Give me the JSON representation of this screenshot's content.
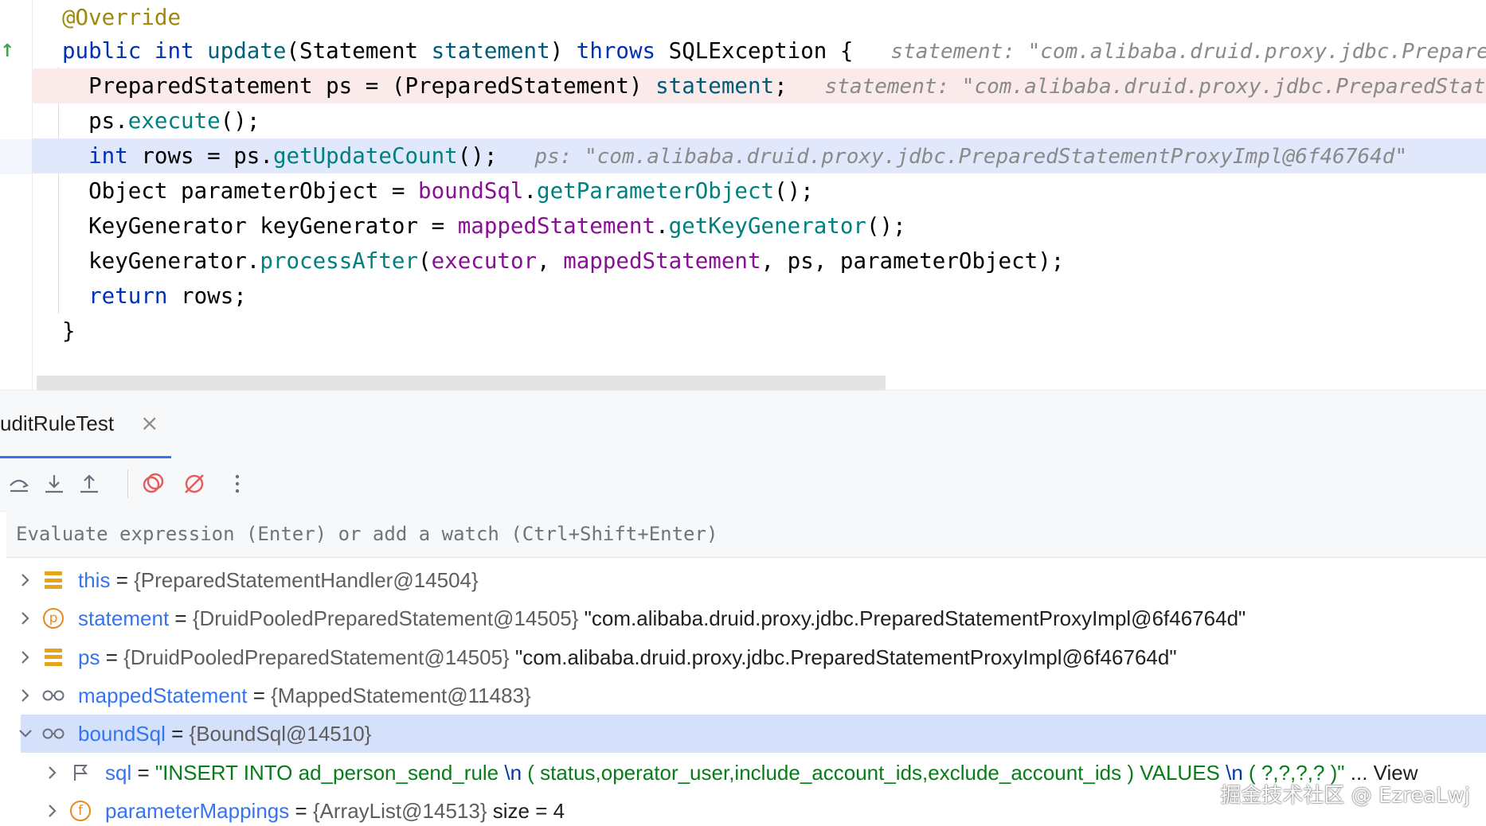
{
  "editor": {
    "lines": [
      [
        {
          "t": "@Override",
          "c": "ann"
        }
      ],
      [
        {
          "t": "public ",
          "c": "kw"
        },
        {
          "t": "int ",
          "c": "kw"
        },
        {
          "t": "update",
          "c": "fn"
        },
        {
          "t": "(",
          "c": "pn"
        },
        {
          "t": "Statement ",
          "c": "pn"
        },
        {
          "t": "statement",
          "c": "prm"
        },
        {
          "t": ") ",
          "c": "pn"
        },
        {
          "t": "throws ",
          "c": "kw"
        },
        {
          "t": "SQLException ",
          "c": "pn"
        },
        {
          "t": "{",
          "c": "pn"
        },
        {
          "t": "   statement: \"com.alibaba.druid.proxy.jdbc.PreparedS",
          "c": "hint"
        }
      ],
      [
        {
          "t": "  PreparedStatement ps = ",
          "c": "pn"
        },
        {
          "t": "(",
          "c": "pn"
        },
        {
          "t": "PreparedStatement",
          "c": "pn"
        },
        {
          "t": ") ",
          "c": "pn"
        },
        {
          "t": "statement",
          "c": "prm"
        },
        {
          "t": ";",
          "c": "pn"
        },
        {
          "t": "   statement: \"com.alibaba.druid.proxy.jdbc.PreparedStatem",
          "c": "hint"
        }
      ],
      [
        {
          "t": "  ps.",
          "c": "pn"
        },
        {
          "t": "execute",
          "c": "mc"
        },
        {
          "t": "();",
          "c": "pn"
        }
      ],
      [
        {
          "t": "  ",
          "c": "pn"
        },
        {
          "t": "int ",
          "c": "kw"
        },
        {
          "t": "rows = ps.",
          "c": "pn"
        },
        {
          "t": "getUpdateCount",
          "c": "mc"
        },
        {
          "t": "();",
          "c": "pn"
        },
        {
          "t": "   ps: \"com.alibaba.druid.proxy.jdbc.PreparedStatementProxyImpl@6f46764d\"",
          "c": "hint"
        }
      ],
      [
        {
          "t": "  Object parameterObject = ",
          "c": "pn"
        },
        {
          "t": "boundSql",
          "c": "fld"
        },
        {
          "t": ".",
          "c": "pn"
        },
        {
          "t": "getParameterObject",
          "c": "mc"
        },
        {
          "t": "();",
          "c": "pn"
        }
      ],
      [
        {
          "t": "  KeyGenerator keyGenerator = ",
          "c": "pn"
        },
        {
          "t": "mappedStatement",
          "c": "fld"
        },
        {
          "t": ".",
          "c": "pn"
        },
        {
          "t": "getKeyGenerator",
          "c": "mc"
        },
        {
          "t": "();",
          "c": "pn"
        }
      ],
      [
        {
          "t": "  keyGenerator.",
          "c": "pn"
        },
        {
          "t": "processAfter",
          "c": "mc"
        },
        {
          "t": "(",
          "c": "pn"
        },
        {
          "t": "executor",
          "c": "fld"
        },
        {
          "t": ", ",
          "c": "pn"
        },
        {
          "t": "mappedStatement",
          "c": "fld"
        },
        {
          "t": ", ps, parameterObject);",
          "c": "pn"
        }
      ],
      [
        {
          "t": "  ",
          "c": "pn"
        },
        {
          "t": "return ",
          "c": "kw"
        },
        {
          "t": "rows;",
          "c": "pn"
        }
      ],
      [
        {
          "t": "}",
          "c": "pn"
        }
      ]
    ]
  },
  "debug": {
    "tab_title": "uditRuleTest",
    "tab_close": "×",
    "eval_placeholder": "Evaluate expression (Enter) or add a watch (Ctrl+Shift+Enter)",
    "toolbar": [
      "step-over-icon",
      "step-into-icon",
      "step-out-icon",
      "view-breakpoints-icon",
      "mute-breakpoints-icon",
      "more-icon"
    ]
  },
  "variables": [
    {
      "name": "this",
      "eq": " = ",
      "type": "{PreparedStatementHandler@14504}",
      "value": "",
      "expanded": false,
      "icon": "field-icon",
      "indent": 0
    },
    {
      "name": "statement",
      "eq": " = ",
      "type": "{DruidPooledPreparedStatement@14505}",
      "value": " \"com.alibaba.druid.proxy.jdbc.PreparedStatementProxyImpl@6f46764d\"",
      "expanded": false,
      "icon": "parameter-icon",
      "indent": 0
    },
    {
      "name": "ps",
      "eq": " = ",
      "type": "{DruidPooledPreparedStatement@14505}",
      "value": " \"com.alibaba.druid.proxy.jdbc.PreparedStatementProxyImpl@6f46764d\"",
      "expanded": false,
      "icon": "field-icon",
      "indent": 0
    },
    {
      "name": "mappedStatement",
      "eq": " = ",
      "type": "{MappedStatement@11483}",
      "value": "",
      "expanded": false,
      "icon": "watch-glasses-icon",
      "indent": 0
    },
    {
      "name": "boundSql",
      "eq": " = ",
      "type": "{BoundSql@14510}",
      "value": "",
      "expanded": true,
      "icon": "watch-glasses-icon",
      "indent": 0,
      "selected": true
    },
    {
      "name": "sql",
      "eq": " = ",
      "type": "",
      "value": "",
      "sql": true,
      "indent": 1,
      "icon": "flag-icon"
    },
    {
      "name": "parameterMappings",
      "eq": " = ",
      "type": "{ArrayList@14513}",
      "value": "  size = 4",
      "expanded": false,
      "icon": "final-field-icon",
      "indent": 1
    }
  ],
  "sql_value": {
    "parts": [
      {
        "t": "\"INSERT INTO ad_person_send_rule ",
        "c": "vstr"
      },
      {
        "t": "\\n",
        "c": "vesc"
      },
      {
        "t": " ( status,operator_user,include_account_ids,exclude_account_ids )  VALUES ",
        "c": "vstr"
      },
      {
        "t": "\\n",
        "c": "vesc"
      },
      {
        "t": " ( ?,?,?,? )\"",
        "c": "vstr"
      },
      {
        "t": " ... ",
        "c": "vplain"
      },
      {
        "t": "View",
        "c": "vlink"
      }
    ]
  },
  "watermark": "掘金技术社区 @ EzreaLwj"
}
